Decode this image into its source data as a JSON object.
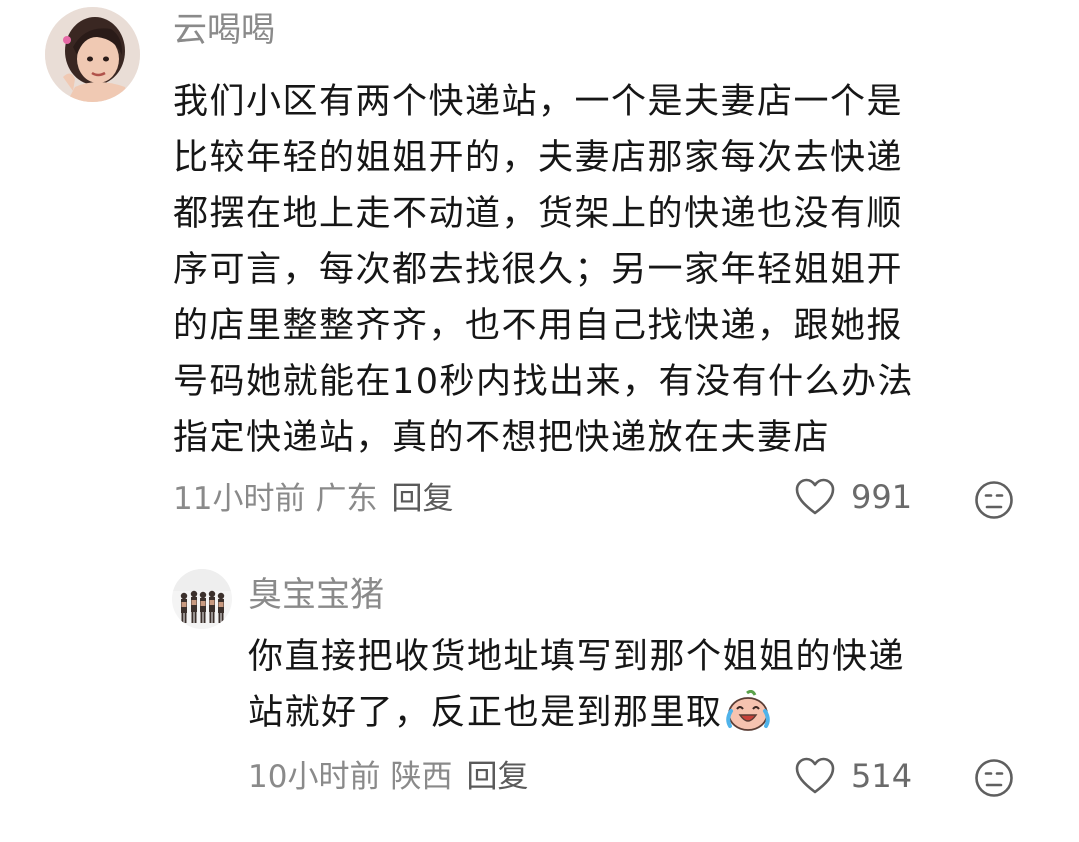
{
  "comments": [
    {
      "username": "云喝喝",
      "content_lines": [
        "我们小区有两个快递站，一个是夫妻店一个是",
        "比较年轻的姐姐开的，夫妻店那家每次去快递",
        "都摆在地上走不动道，货架上的快递也没有顺",
        "序可言，每次都去找很久；另一家年轻姐姐开",
        "的店里整整齐齐，也不用自己找快递，跟她报",
        "号码她就能在10秒内找出来，有没有什么办法",
        "指定快递站，真的不想把快递放在夫妻店"
      ],
      "time": "11小时前",
      "location": "广东",
      "reply_label": "回复",
      "likes": "991",
      "avatar_icon": "girl-avatar",
      "like_icon": "heart-outline-icon",
      "dislike_icon": "frown-face-icon"
    },
    {
      "username": "臭宝宝猪",
      "content_lines": [
        "你直接把收货地址填写到那个姐姐的快递",
        "站就好了，反正也是到那里取"
      ],
      "emoji": "laugh-cry-sticker",
      "time": "10小时前",
      "location": "陕西",
      "reply_label": "回复",
      "likes": "514",
      "avatar_icon": "group-photo-avatar",
      "like_icon": "heart-outline-icon",
      "dislike_icon": "frown-face-icon"
    }
  ],
  "colors": {
    "username": "#8a8a8a",
    "content": "#161616",
    "meta": "#8a8a8a",
    "reply": "#5a5a5a",
    "icon": "#5f5f5f"
  }
}
